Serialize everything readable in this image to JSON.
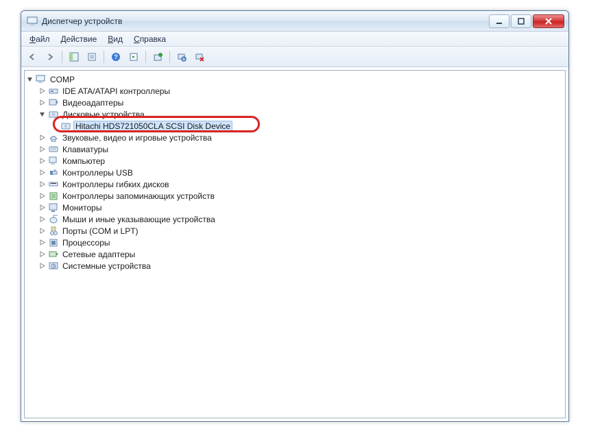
{
  "window": {
    "title": "Диспетчер устройств"
  },
  "menu": {
    "file": "Файл",
    "action": "Действие",
    "view": "Вид",
    "help": "Справка",
    "file_u": "Ф",
    "action_u": "Д",
    "view_u": "В",
    "help_u": "С",
    "file_rest": "айл",
    "action_rest": "ействие",
    "view_rest": "ид",
    "help_rest": "правка"
  },
  "tree": {
    "root": "COMP",
    "items": [
      "IDE ATA/ATAPI контроллеры",
      "Видеоадаптеры",
      "Дисковые устройства",
      "Звуковые, видео и игровые устройства",
      "Клавиатуры",
      "Компьютер",
      "Контроллеры USB",
      "Контроллеры гибких дисков",
      "Контроллеры запоминающих устройств",
      "Мониторы",
      "Мыши и иные указывающие устройства",
      "Порты (COM и LPT)",
      "Процессоры",
      "Сетевые адаптеры",
      "Системные устройства"
    ],
    "disk_child": "Hitachi HDS721050CLA SCSI Disk Device"
  }
}
